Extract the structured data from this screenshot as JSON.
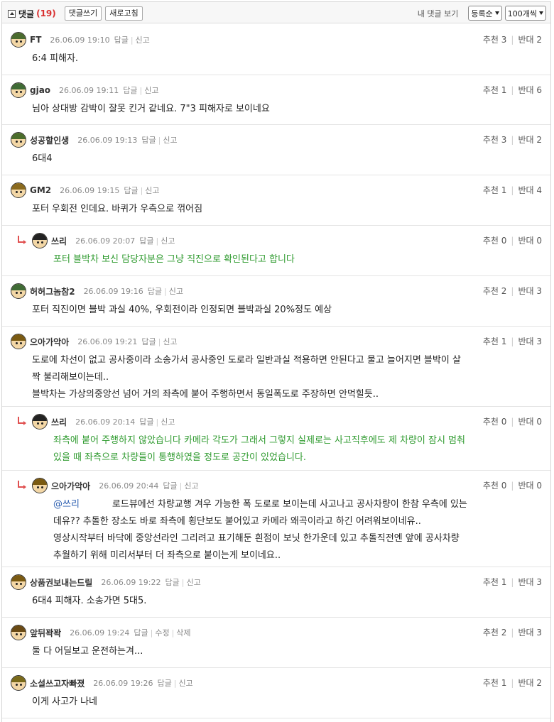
{
  "toolbar": {
    "title": "댓글",
    "count": "(19)",
    "write_label": "댓글쓰기",
    "refresh_label": "새로고침",
    "my_comments_label": "내 댓글 보기",
    "sort_value": "등록순",
    "per_page_value": "100개씩"
  },
  "labels": {
    "reply": "답글",
    "report": "신고",
    "edit": "수정",
    "delete": "삭제",
    "up": "추천",
    "down": "반대"
  },
  "comments": [
    {
      "nick": "FT",
      "date": "26.06.09 19:10",
      "up": "3",
      "down": "2",
      "lines": [
        "6:4 피해자."
      ],
      "hair": "#4a6b2e"
    },
    {
      "nick": "gjao",
      "date": "26.06.09 19:11",
      "up": "1",
      "down": "6",
      "lines": [
        "님아 상대방 감박이 잘못 킨거 같네요. 7\"3 피해자로 보이네요"
      ],
      "hair": "#3f6b35"
    },
    {
      "nick": "성공할인생",
      "date": "26.06.09 19:13",
      "up": "3",
      "down": "2",
      "lines": [
        "6대4"
      ],
      "hair": "#4b6d2b"
    },
    {
      "nick": "GM2",
      "date": "26.06.09 19:15",
      "up": "1",
      "down": "4",
      "lines": [
        "포터 우회전 인데요. 바퀴가 우측으로 꺾어짐"
      ],
      "hair": "#8a6a1e"
    },
    {
      "nick": "쓰리",
      "date": "26.06.09 20:07",
      "up": "0",
      "down": "0",
      "lines": [
        "포터 블박차 보신 담당자분은 그냥 직진으로 확인된다고 합니다"
      ],
      "hair": "#222222"
    },
    {
      "nick": "허허그놈참2",
      "date": "26.06.09 19:16",
      "up": "2",
      "down": "3",
      "lines": [
        "포터 직진이면 블박 과실 40%, 우회전이라 인정되면 블박과실 20%정도 예상"
      ],
      "hair": "#3f6b35"
    },
    {
      "nick": "으아가악아",
      "date": "26.06.09 19:21",
      "up": "1",
      "down": "3",
      "lines": [
        "도로에 차선이 없고 공사중이라 소송가서 공사중인 도로라 일반과실 적용하면 안된다고 물고 늘어지면 블박이 살",
        "짝 불리해보이는데..",
        "블박차는 가상의중앙선 넘어 거의 좌측에 붙어 주행하면서 동일폭도로 주장하면 안먹힐듯.."
      ],
      "hair": "#7a5a12"
    },
    {
      "nick": "쓰리",
      "date": "26.06.09 20:14",
      "up": "0",
      "down": "0",
      "lines": [
        "좌측에 붙어 주행하지 않았습니다 카메라 각도가 그래서 그렇지 실제로는 사고직후에도 제 차량이 잠시 멈춰",
        "있을 때 좌측으로 차량들이 통행하였을 정도로 공간이 있었습니다."
      ],
      "hair": "#222222"
    },
    {
      "nick": "으아가악아",
      "date": "26.06.09 20:44",
      "up": "0",
      "down": "0",
      "mention": "@쓰리",
      "lines": [
        "로드뷰에선 차량교행 겨우 가능한 폭 도로로 보이는데 사고나고 공사차량이 한참 우측에 있는",
        "데유?? 추돌한 장소도 바로 좌측에 횡단보도 붙어있고 카메라 왜곡이라고 하긴 어려워보이네유..",
        "영상시작부터 바닥에 중앙선라인 그리려고 표기해둔 흰점이 보닛 한가운데 있고 추돌직전엔 앞에 공사차량",
        "추월하기 위해 미리서부터 더 좌측으로 붙이는게 보이네요.."
      ],
      "hair": "#7a5a12"
    },
    {
      "nick": "상품권보내는드릴",
      "date": "26.06.09 19:22",
      "up": "1",
      "down": "3",
      "lines": [
        "6대4 피해자. 소송가면 5대5."
      ],
      "hair": "#7a5a12"
    },
    {
      "nick": "앞뒤꽉꽉",
      "date": "26.06.09 19:24",
      "up": "2",
      "down": "3",
      "lines": [
        "둘 다 어딜보고 운전하는겨..."
      ],
      "hair": "#6a4a14"
    },
    {
      "nick": "소설쓰고자빠졌",
      "date": "26.06.09 19:26",
      "up": "1",
      "down": "2",
      "lines": [
        "이게 사고가 나네"
      ],
      "hair": "#7a6a1a"
    }
  ]
}
